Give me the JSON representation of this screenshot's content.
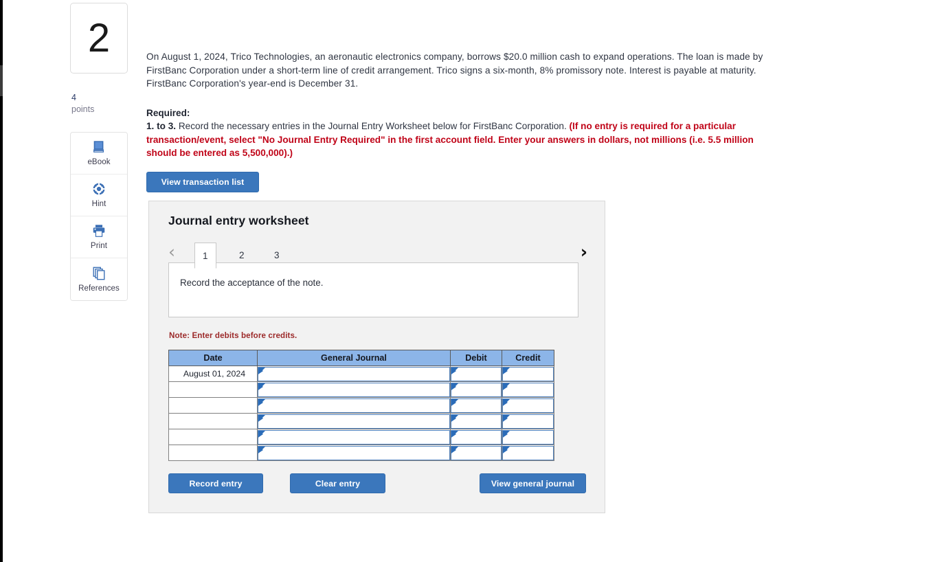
{
  "question": {
    "number": "2",
    "points_value": "4",
    "points_word": "points"
  },
  "tools": [
    {
      "label": "eBook",
      "icon": "book-icon"
    },
    {
      "label": "Hint",
      "icon": "life-preserver-icon"
    },
    {
      "label": "Print",
      "icon": "printer-icon"
    },
    {
      "label": "References",
      "icon": "pages-stack-icon"
    }
  ],
  "problem": {
    "body": "On August 1, 2024, Trico Technologies, an aeronautic electronics company, borrows $20.0 million cash to expand operations. The loan is made by FirstBanc Corporation under a short-term line of credit arrangement. Trico signs a six-month, 8% promissory note. Interest is payable at maturity. FirstBanc Corporation's year-end is December 31."
  },
  "required": {
    "heading": "Required:",
    "item_prefix": "1. to 3.",
    "item_text": " Record the necessary entries in the Journal Entry Worksheet below for FirstBanc Corporation. ",
    "red_note": "(If no entry is required for a particular transaction/event, select \"No Journal Entry Required\" in the first account field. Enter your answers in dollars, not millions (i.e. 5.5 million should be entered as 5,500,000).)"
  },
  "buttons": {
    "view_transaction_list": "View transaction list",
    "record_entry": "Record entry",
    "clear_entry": "Clear entry",
    "view_general_journal": "View general journal"
  },
  "worksheet": {
    "title": "Journal entry worksheet",
    "prev_chevron": "‹",
    "next_chevron": "›",
    "tabs": [
      {
        "label": "1",
        "active": true
      },
      {
        "label": "2",
        "active": false
      },
      {
        "label": "3",
        "active": false
      }
    ],
    "panel_text": "Record the acceptance of the note.",
    "note": "Note: Enter debits before credits.",
    "table": {
      "headers": [
        "Date",
        "General Journal",
        "Debit",
        "Credit"
      ],
      "rows": [
        {
          "date": "August 01, 2024",
          "general_journal": "",
          "debit": "",
          "credit": ""
        },
        {
          "date": "",
          "general_journal": "",
          "debit": "",
          "credit": ""
        },
        {
          "date": "",
          "general_journal": "",
          "debit": "",
          "credit": ""
        },
        {
          "date": "",
          "general_journal": "",
          "debit": "",
          "credit": ""
        },
        {
          "date": "",
          "general_journal": "",
          "debit": "",
          "credit": ""
        },
        {
          "date": "",
          "general_journal": "",
          "debit": "",
          "credit": ""
        }
      ]
    }
  },
  "colors": {
    "accent_blue": "#3b77bc",
    "table_header_blue": "#8cb5e8",
    "red_note": "#c00418",
    "note_maroon": "#9c2a2a",
    "panel_gray": "#f2f2f2"
  }
}
